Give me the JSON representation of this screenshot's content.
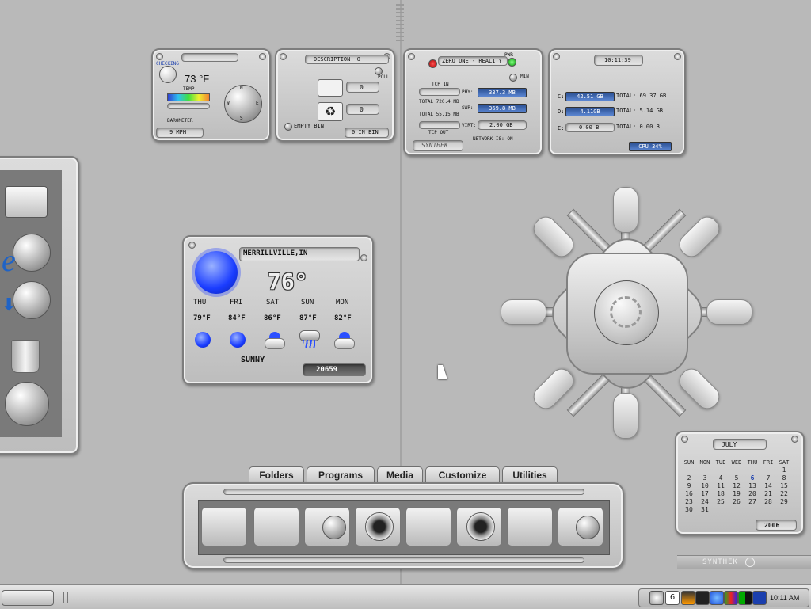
{
  "weather_mini": {
    "status": "CHECKING",
    "temp": "73 °F",
    "temp_label": "TEMP",
    "barometer_label": "BAROMETER",
    "wind": "9 MPH",
    "compass_n": "N",
    "compass_s": "S",
    "compass_e": "E",
    "compass_w": "W"
  },
  "recycle": {
    "description": "DESCRIPTION: 0",
    "poll": "POLL",
    "count1": "0",
    "count2": "0",
    "empty_bin": "EMPTY BIN",
    "in_bin": "0 IN BIN"
  },
  "network": {
    "title": "ZERO ONE - REALITY",
    "pwr": "PWR",
    "min": "MIN",
    "tcp_in": "TCP IN",
    "phy_label": "PHY:",
    "phy": "337.3 MB",
    "total1": "TOTAL 720.4 MB",
    "swp_label": "SWP:",
    "swp": "369.8 MB",
    "total2": "TOTAL 55.15 MB",
    "virt_label": "VIRT:",
    "virt": "2.00 GB",
    "tcp_out": "TCP OUT",
    "brand": "SYNTHEK",
    "network_status": "NETWORK IS: ON"
  },
  "drives": {
    "time": "10:11:39",
    "c_label": "C:",
    "c_free": "42.51 GB",
    "c_total": "TOTAL: 69.37 GB",
    "d_label": "D:",
    "d_free": "4.11GB",
    "d_total": "TOTAL: 5.14 GB",
    "e_label": "E:",
    "e_free": "0.00 B",
    "e_total": "TOTAL: 0.00 B",
    "cpu": "CPU 34%"
  },
  "forecast": {
    "location": "MERRILLVILLE,IN",
    "current_temp": "76°",
    "condition": "SUNNY",
    "zip": "20659",
    "days": [
      {
        "day": "THU",
        "temp": "79°F",
        "icon": "sun-icon"
      },
      {
        "day": "FRI",
        "temp": "84°F",
        "icon": "sun-icon"
      },
      {
        "day": "SAT",
        "temp": "86°F",
        "icon": "partly-cloudy-icon"
      },
      {
        "day": "SUN",
        "temp": "87°F",
        "icon": "storm-icon"
      },
      {
        "day": "MON",
        "temp": "82°F",
        "icon": "partly-cloudy-icon"
      }
    ]
  },
  "dock_tabs": {
    "folders": "Folders",
    "programs": "Programs",
    "media": "Media",
    "customize": "Customize",
    "utilities": "Utilities"
  },
  "calendar": {
    "month": "JULY",
    "year": "2006",
    "weekdays": [
      "SUN",
      "MON",
      "TUE",
      "WED",
      "THU",
      "FRI",
      "SAT"
    ],
    "weeks": [
      [
        "",
        "",
        "",
        "",
        "",
        "",
        "1"
      ],
      [
        "2",
        "3",
        "4",
        "5",
        "6",
        "7",
        "8"
      ],
      [
        "9",
        "10",
        "11",
        "12",
        "13",
        "14",
        "15"
      ],
      [
        "16",
        "17",
        "18",
        "19",
        "20",
        "21",
        "22"
      ],
      [
        "23",
        "24",
        "25",
        "26",
        "27",
        "28",
        "29"
      ],
      [
        "30",
        "31",
        "",
        "",
        "",
        "",
        ""
      ]
    ],
    "today": "6"
  },
  "synthek_logo": "SYNTHEK",
  "taskbar": {
    "clock": "10:11 AM",
    "tray_count": "6"
  },
  "colors": {
    "accent_blue": "#2a4f92",
    "metal_light": "#dcdcdc",
    "metal_dark": "#7d7d7d",
    "desktop": "#b9b9b9",
    "today_blue": "#1b3fae"
  }
}
